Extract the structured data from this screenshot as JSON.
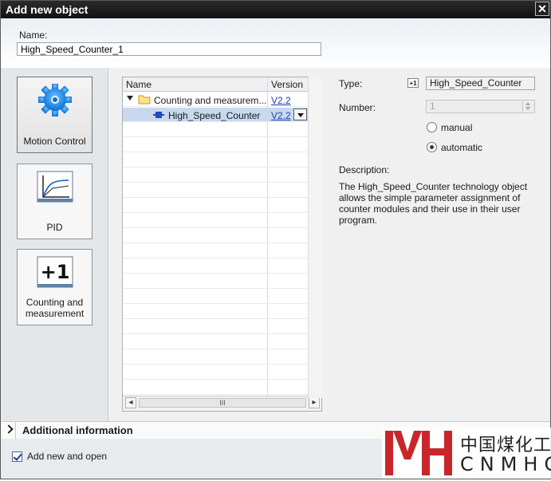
{
  "dialog": {
    "title": "Add new object",
    "close_glyph": "✕"
  },
  "name": {
    "label": "Name:",
    "value": "High_Speed_Counter_1"
  },
  "categories": [
    {
      "label_lines": [
        "Motion Control"
      ],
      "icon": "gear-icon"
    },
    {
      "label_lines": [
        "PID"
      ],
      "icon": "pid-curve-icon"
    },
    {
      "label_lines": [
        "Counting and",
        "measurement"
      ],
      "icon": "plus-one-icon"
    }
  ],
  "tree": {
    "col_name": "Name",
    "col_version": "Version",
    "rows": [
      {
        "name": "Counting and measurem...",
        "version": "V2.2",
        "type": "folder"
      },
      {
        "name": "High_Speed_Counter",
        "version": "V2.2",
        "type": "object"
      }
    ],
    "scroll_grip": "III"
  },
  "properties": {
    "type_label": "Type:",
    "type_badge": "+1",
    "type_value": "High_Speed_Counter",
    "number_label": "Number:",
    "number_value": "1",
    "radio_manual": "manual",
    "radio_automatic": "automatic",
    "description_label": "Description:",
    "description_text": "The High_Speed_Counter technology object allows the simple parameter assignment of counter modules and their use in their user program."
  },
  "additional_info": {
    "label": "Additional  information"
  },
  "footer": {
    "checkbox_label": "Add new and open",
    "checked": true
  },
  "watermark": {
    "chinese": "中国煤化工",
    "latin": "CNMHG"
  },
  "colors": {
    "accent_red": "#c9262c",
    "link_blue": "#1c3fb0",
    "selection": "#c8d9ef"
  }
}
